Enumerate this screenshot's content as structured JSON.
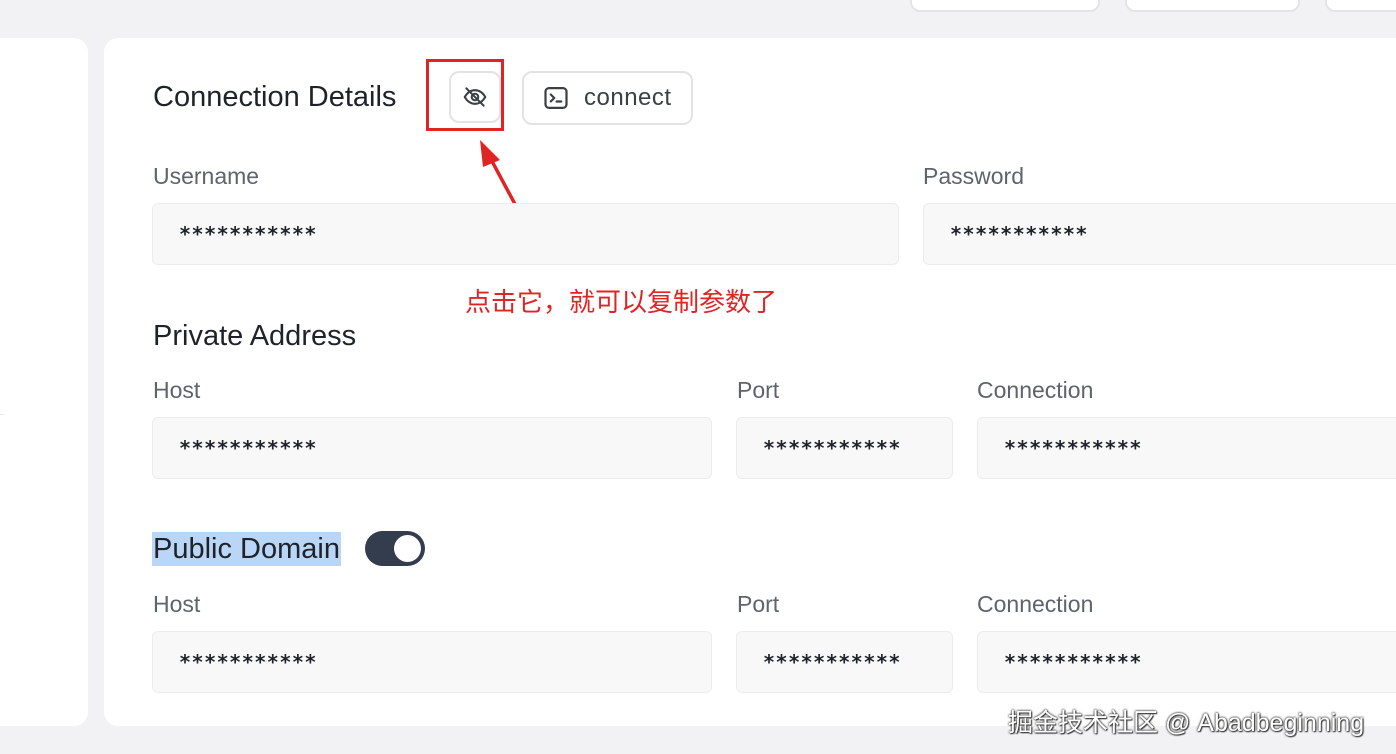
{
  "connection": {
    "title": "Connection Details",
    "toggle_visibility_icon": "eye-off-icon",
    "connect_icon": "terminal-icon",
    "connect_label": "connect",
    "username_label": "Username",
    "username_value": "***********",
    "password_label": "Password",
    "password_value": "***********"
  },
  "annotation": {
    "text": "点击它，就可以复制参数了",
    "color": "#e02424"
  },
  "private_address": {
    "title": "Private Address",
    "host_label": "Host",
    "host_value": "***********",
    "port_label": "Port",
    "port_value": "***********",
    "connection_label": "Connection",
    "connection_value": "***********"
  },
  "public_domain": {
    "title": "Public Domain",
    "enabled": true,
    "host_label": "Host",
    "host_value": "***********",
    "port_label": "Port",
    "port_value": "***********",
    "connection_label": "Connection",
    "connection_value": "***********"
  },
  "watermark": "掘金技术社区 @ Abadbeginning",
  "colors": {
    "toggle_on": "#343d4d",
    "selection_highlight": "#b9d6f7"
  }
}
